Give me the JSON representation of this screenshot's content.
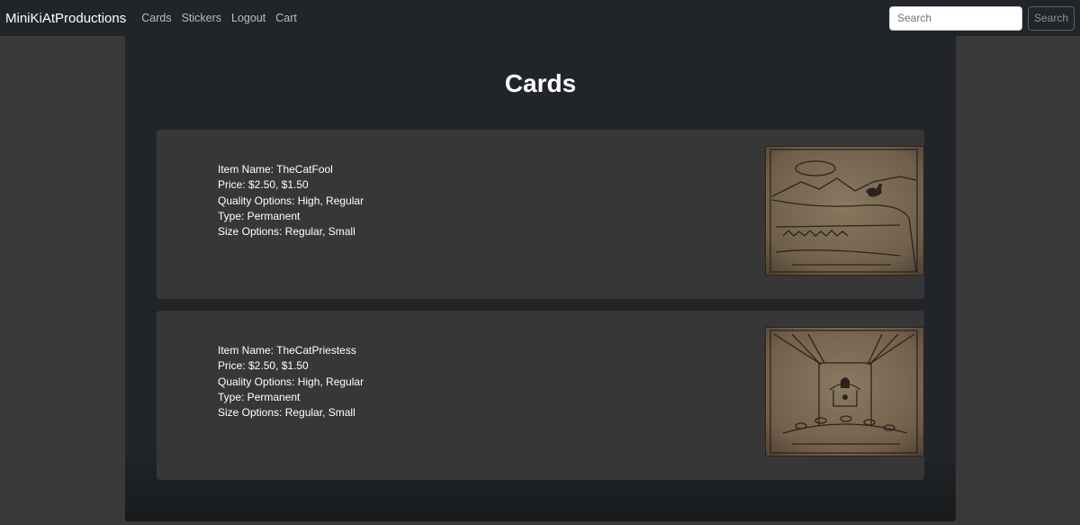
{
  "navbar": {
    "brand": "MiniKiAtProductions",
    "links": [
      "Cards",
      "Stickers",
      "Logout",
      "Cart"
    ],
    "search": {
      "placeholder": "Search",
      "value": "",
      "button_label": "Search"
    }
  },
  "page": {
    "title": "Cards"
  },
  "items": [
    {
      "name_line": "Item Name: TheCatFool",
      "price_line": "Price: $2.50, $1.50",
      "quality_line": "Quality Options: High, Regular",
      "type_line": "Type: Permanent",
      "size_line": "Size Options: Regular, Small",
      "image_label": "TheCatFool card sketch"
    },
    {
      "name_line": "Item Name: TheCatPriestess",
      "price_line": "Price: $2.50, $1.50",
      "quality_line": "Quality Options: High, Regular",
      "type_line": "Type: Permanent",
      "size_line": "Size Options: Regular, Small",
      "image_label": "TheCatPriestess card sketch"
    }
  ],
  "colors": {
    "background": "#3a3937",
    "navbar": "#212529",
    "content": "#212529",
    "card": "#373737",
    "sketch_paper": "#7b6b55"
  }
}
